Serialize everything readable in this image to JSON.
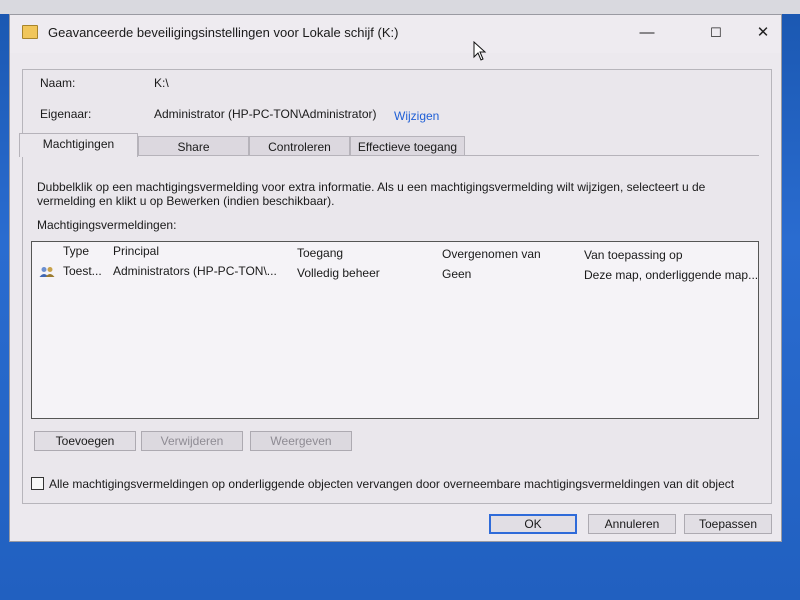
{
  "window": {
    "title": "Geavanceerde beveiligingsinstellingen voor Lokale schijf (K:)",
    "minimize_glyph": "—",
    "maximize_glyph": "☐",
    "close_glyph": "✕"
  },
  "header": {
    "name_label": "Naam:",
    "name_value": "K:\\",
    "owner_label": "Eigenaar:",
    "owner_value": "Administrator (HP-PC-TON\\Administrator)",
    "change_link": "Wijzigen"
  },
  "tabs": [
    {
      "label": "Machtigingen",
      "active": true
    },
    {
      "label": "Share",
      "active": false
    },
    {
      "label": "Controleren",
      "active": false
    },
    {
      "label": "Effectieve toegang",
      "active": false
    }
  ],
  "permissions": {
    "info_line1": "Dubbelklik op een machtigingsvermelding voor extra informatie. Als u een machtigingsvermelding wilt wijzigen, selecteert u de",
    "info_line2": "vermelding en klikt u op Bewerken (indien beschikbaar).",
    "list_label": "Machtigingsvermeldingen:",
    "columns": [
      "Type",
      "Principal",
      "Toegang",
      "Overgenomen van",
      "Van toepassing op"
    ],
    "rows": [
      {
        "icon": "users-icon",
        "type": "Toest...",
        "principal": "Administrators (HP-PC-TON\\...",
        "access": "Volledig beheer",
        "inherited_from": "Geen",
        "applies_to": "Deze map, onderliggende map..."
      }
    ],
    "add_button": "Toevoegen",
    "remove_button": "Verwijderen",
    "view_button": "Weergeven",
    "replace_checkbox_label": "Alle machtigingsvermeldingen op onderliggende objecten vervangen door overneembare machtigingsvermeldingen van dit object",
    "replace_checked": false
  },
  "footer": {
    "ok_button": "OK",
    "cancel_button": "Annuleren",
    "apply_button": "Toepassen"
  },
  "colors": {
    "link": "#1f5fd6",
    "focus_border": "#2f6bd9",
    "desktop": "#2160c0"
  }
}
